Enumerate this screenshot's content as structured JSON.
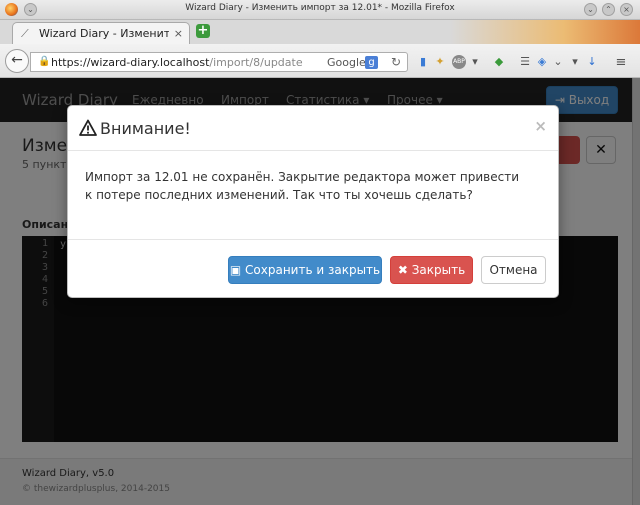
{
  "window": {
    "title": "Wizard Diary - Изменить импорт за 12.01* - Mozilla Firefox"
  },
  "browser": {
    "tab_label": "Wizard Diary - Изменит...",
    "url_host": "https://wizard-diary.localhost",
    "url_path": "/import/8/update",
    "search_engine": "Google",
    "search_badge": "g"
  },
  "app": {
    "brand": "Wizard Diary",
    "nav": [
      "Ежедневно",
      "Импорт",
      "Статистика ▾",
      "Прочее ▾"
    ],
    "logout_label": "Выход",
    "page_title": "Измен",
    "page_subtitle": "5 пункто",
    "description_label": "Описан",
    "line_numbers": [
      "1",
      "2",
      "3",
      "4",
      "5",
      "6"
    ],
    "code_first_char": "у",
    "footer_title": "Wizard Diary, v5.0",
    "footer_copyright": "© thewizardplusplus, 2014-2015"
  },
  "modal": {
    "title": "Внимание!",
    "close_glyph": "×",
    "message": "Импорт за 12.01 не сохранён. Закрытие редактора может привести к потере последних изменений. Так что ты хочешь сделать?",
    "save_close_label": "Сохранить и закрыть",
    "close_label": "Закрыть",
    "cancel_label": "Отмена"
  },
  "colors": {
    "primary": "#428bca",
    "danger": "#d9534f",
    "navbar": "#222222"
  }
}
